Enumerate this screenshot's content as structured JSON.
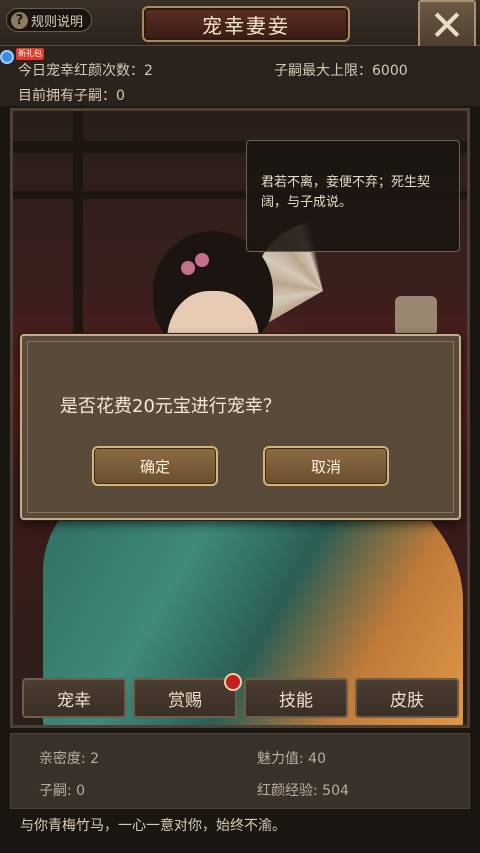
{
  "header": {
    "rules_label": "规则说明",
    "title": "宠幸妻妾",
    "close_glyph": "✕"
  },
  "info": {
    "gift_badge": "新礼包",
    "daily_favor": "今日宠幸红颜次数：2",
    "heir_limit": "子嗣最大上限：6000",
    "current_heirs": "目前拥有子嗣：0"
  },
  "portrait": {
    "speech": "君若不离，妾便不弃；死生契阔，与子成说。"
  },
  "dialog": {
    "message": "是否花费20元宝进行宠幸？",
    "confirm_label": "确定",
    "cancel_label": "取消"
  },
  "actions": [
    {
      "label": "宠幸"
    },
    {
      "label": "赏赐"
    },
    {
      "label": "技能"
    },
    {
      "label": "皮肤"
    }
  ],
  "stats": {
    "intimacy": "亲密度: 2",
    "charm": "魅力值: 40",
    "children": "子嗣: 0",
    "exp": "红颜经验: 504"
  },
  "quote": "与你青梅竹马，一心一意对你，始终不渝。",
  "colors": {
    "accent_gold": "#c4ad88",
    "dialog_bg": "#5a4a3a",
    "title_red": "#5b2e24"
  }
}
